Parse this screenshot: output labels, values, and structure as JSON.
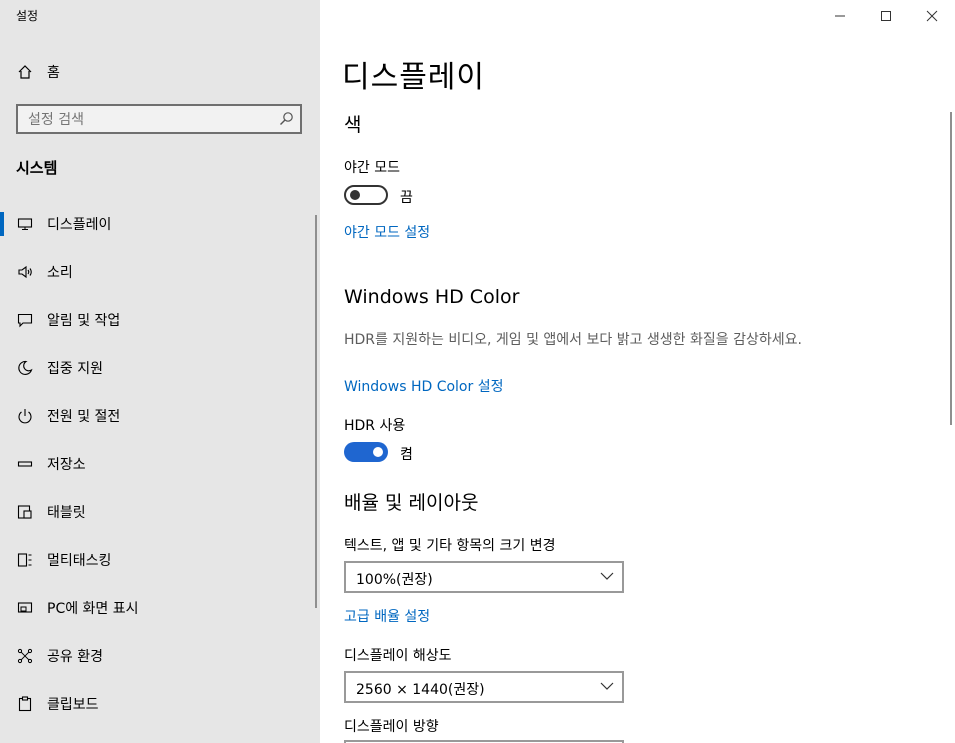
{
  "app": {
    "title": "설정"
  },
  "sidebar": {
    "home": "홈",
    "search_placeholder": "설정 검색",
    "section": "시스템",
    "items": [
      {
        "label": "디스플레이",
        "icon": "monitor-icon",
        "selected": true
      },
      {
        "label": "소리",
        "icon": "speaker-icon"
      },
      {
        "label": "알림 및 작업",
        "icon": "message-icon"
      },
      {
        "label": "집중 지원",
        "icon": "moon-icon"
      },
      {
        "label": "전원 및 절전",
        "icon": "power-icon"
      },
      {
        "label": "저장소",
        "icon": "storage-icon"
      },
      {
        "label": "태블릿",
        "icon": "tablet-icon"
      },
      {
        "label": "멀티태스킹",
        "icon": "multitask-icon"
      },
      {
        "label": "PC에 화면 표시",
        "icon": "project-icon"
      },
      {
        "label": "공유 환경",
        "icon": "share-icon"
      },
      {
        "label": "클립보드",
        "icon": "clipboard-icon"
      }
    ]
  },
  "main": {
    "title": "디스플레이",
    "color_section": "색",
    "night_light_label": "야간 모드",
    "night_light_state": "끔",
    "night_light_on": false,
    "night_light_link": "야간 모드 설정",
    "hd_color_section": "Windows HD Color",
    "hd_color_desc": "HDR를 지원하는 비디오, 게임 및 앱에서 보다 밝고 생생한 화질을 감상하세요.",
    "hd_color_link": "Windows HD Color 설정",
    "hdr_label": "HDR 사용",
    "hdr_state": "켬",
    "hdr_on": true,
    "scale_section": "배율 및 레이아웃",
    "scale_label": "텍스트, 앱 및 기타 항목의 크기 변경",
    "scale_value": "100%(권장)",
    "advanced_scale_link": "고급 배율 설정",
    "resolution_label": "디스플레이 해상도",
    "resolution_value": "2560 × 1440(권장)",
    "orientation_label": "디스플레이 방향"
  },
  "colors": {
    "accent": "#0067c0",
    "toggle_on": "#1f66d0",
    "sidebar_bg": "#e6e6e6"
  }
}
